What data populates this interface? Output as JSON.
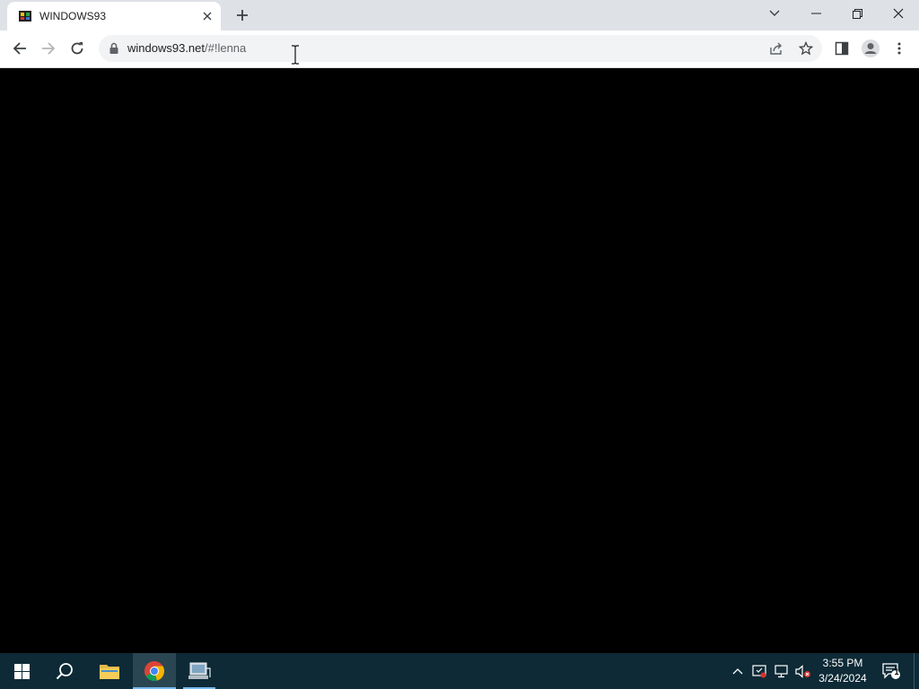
{
  "browser": {
    "tab": {
      "title": "WINDOWS93",
      "favicon": "windows93-favicon"
    },
    "address": {
      "host": "windows93.net",
      "path": "/#!lenna"
    }
  },
  "taskbar": {
    "time": "3:55 PM",
    "date": "3/24/2024",
    "notification_count": "1"
  },
  "colors": {
    "tabbar": "#dee1e6",
    "content": "#000000",
    "taskbar": "#0d2a36",
    "accent": "#76b9ed"
  }
}
